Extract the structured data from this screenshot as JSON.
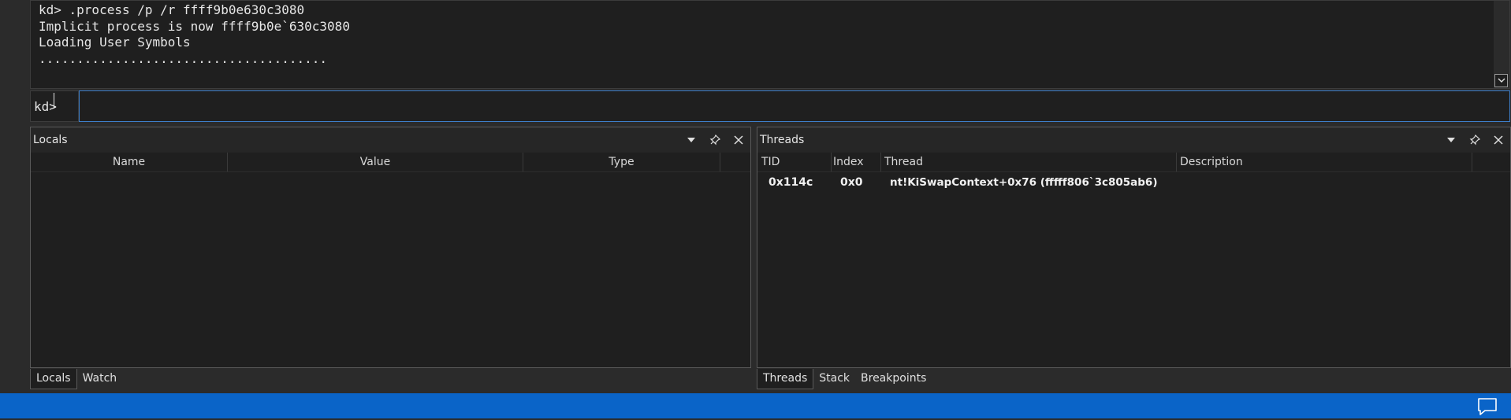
{
  "console": {
    "lines": [
      "kd> .process /p /r ffff9b0e630c3080",
      "Implicit process is now ffff9b0e`630c3080",
      "Loading User Symbols",
      "......................................"
    ]
  },
  "command": {
    "prompt": "kd>",
    "value": ""
  },
  "locals_pane": {
    "title": "Locals",
    "columns": [
      "Name",
      "Value",
      "Type"
    ],
    "tabs": [
      "Locals",
      "Watch"
    ]
  },
  "threads_pane": {
    "title": "Threads",
    "columns": [
      "TID",
      "Index",
      "Thread",
      "Description"
    ],
    "rows": [
      {
        "tid": "0x114c",
        "index": "0x0",
        "thread": "nt!KiSwapContext+0x76 (fffff806`3c805ab6)",
        "description": ""
      }
    ],
    "tabs": [
      "Threads",
      "Stack",
      "Breakpoints"
    ]
  },
  "icons": {
    "dropdown": "chevron-down-icon",
    "pin": "pin-icon",
    "close": "close-icon",
    "feedback": "feedback-icon"
  },
  "colors": {
    "statusbar": "#0a64c8",
    "input_border": "#3d7ec9"
  }
}
